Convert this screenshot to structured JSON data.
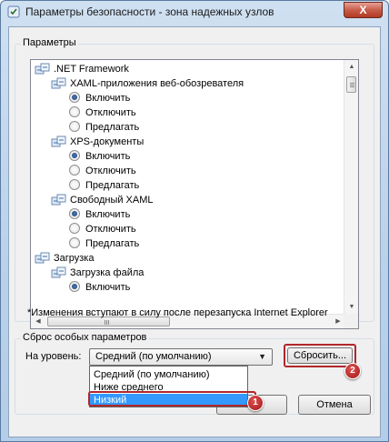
{
  "window": {
    "title": "Параметры безопасности - зона надежных узлов",
    "close": "X"
  },
  "settings": {
    "group_label": "Параметры",
    "tree": [
      {
        "type": "folder",
        "label": ".NET Framework",
        "indent": 0
      },
      {
        "type": "folder",
        "label": "XAML-приложения веб-обозревателя",
        "indent": 1
      },
      {
        "type": "radio",
        "label": "Включить",
        "checked": true,
        "indent": 2
      },
      {
        "type": "radio",
        "label": "Отключить",
        "checked": false,
        "indent": 2
      },
      {
        "type": "radio",
        "label": "Предлагать",
        "checked": false,
        "indent": 2
      },
      {
        "type": "folder",
        "label": "XPS-документы",
        "indent": 1
      },
      {
        "type": "radio",
        "label": "Включить",
        "checked": true,
        "indent": 2
      },
      {
        "type": "radio",
        "label": "Отключить",
        "checked": false,
        "indent": 2
      },
      {
        "type": "radio",
        "label": "Предлагать",
        "checked": false,
        "indent": 2
      },
      {
        "type": "folder",
        "label": "Свободный XAML",
        "indent": 1
      },
      {
        "type": "radio",
        "label": "Включить",
        "checked": true,
        "indent": 2
      },
      {
        "type": "radio",
        "label": "Отключить",
        "checked": false,
        "indent": 2
      },
      {
        "type": "radio",
        "label": "Предлагать",
        "checked": false,
        "indent": 2
      },
      {
        "type": "folder",
        "label": "Загрузка",
        "indent": 0
      },
      {
        "type": "folder",
        "label": "Загрузка файла",
        "indent": 1
      },
      {
        "type": "radio",
        "label": "Включить",
        "checked": true,
        "indent": 2
      }
    ],
    "note": "*Изменения вступают в силу после перезапуска Internet Explorer"
  },
  "reset": {
    "group_label": "Сброс особых параметров",
    "level_label": "На уровень:",
    "selected": "Средний (по умолчанию)",
    "options": [
      "Средний (по умолчанию)",
      "Ниже среднего",
      "Низкий"
    ],
    "reset_button": "Сбросить...",
    "badge_1": "1",
    "badge_2": "2"
  },
  "buttons": {
    "cancel": "Отмена"
  },
  "colors": {
    "highlight": "#b2262b",
    "selection": "#3399ff"
  }
}
